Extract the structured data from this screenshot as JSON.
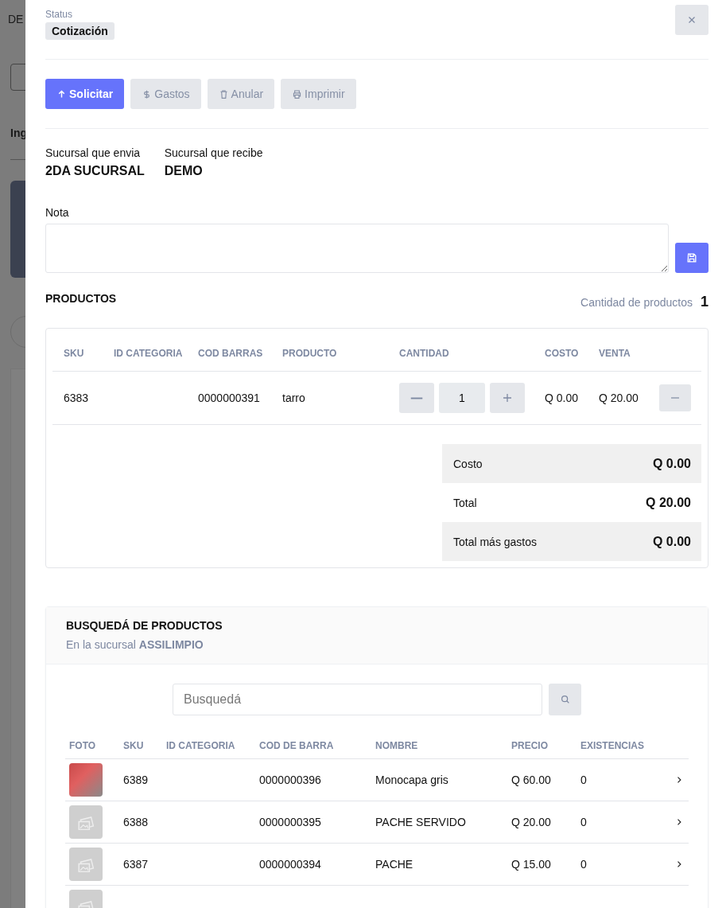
{
  "backdrop": {
    "texts": [
      "DE",
      "Ing"
    ]
  },
  "drawer": {
    "status": {
      "label": "Status",
      "value": "Cotización"
    },
    "actions": [
      {
        "label": "Solicitar",
        "kind": "request"
      },
      {
        "label": "Gastos",
        "kind": "expenses"
      },
      {
        "label": "Anular",
        "kind": "void"
      },
      {
        "label": "Imprimir",
        "kind": "print"
      }
    ],
    "branches": [
      {
        "label": "Sucursal que envia",
        "value": "2DA SUCURSAL"
      },
      {
        "label": "Sucursal que recibe",
        "value": "DEMO"
      }
    ],
    "note": {
      "label": "Nota"
    },
    "products": {
      "title": "PRODUCTOS",
      "count_label": "Cantidad de productos",
      "count": "1",
      "columns": [
        "SKU",
        "ID CATEGORIA",
        "COD BARRAS",
        "PRODUCTO",
        "CANTIDAD",
        "COSTO",
        "VENTA"
      ],
      "rows": [
        {
          "sku": "6383",
          "barcode": "0000000391",
          "product": "tarro",
          "quantity": "1",
          "cost": "Q 0.00",
          "sale": "Q 20.00"
        }
      ],
      "summary": [
        {
          "label": "Costo",
          "value": "Q 0.00",
          "shaded": true
        },
        {
          "label": "Total",
          "value": "Q 20.00",
          "shaded": false
        },
        {
          "label": "Total más gastos",
          "value": "Q 0.00",
          "shaded": true
        }
      ]
    },
    "search": {
      "title": "BUSQUEDÁ DE PRODUCTOS",
      "subtitle": "En la sucursal **ASSILIMPIO**",
      "placeholder": "Busquedá",
      "columns": [
        "FOTO",
        "SKU",
        "ID CATEGORIA",
        "COD DE BARRA",
        "NOMBRE",
        "PRECIO",
        "EXISTENCIAS"
      ],
      "rows": [
        {
          "has_photo": true,
          "sku": "6389",
          "barcode": "0000000396",
          "name": "Monocapa gris",
          "price": "Q 60.00",
          "stock": "0"
        },
        {
          "has_photo": false,
          "sku": "6388",
          "barcode": "0000000395",
          "name": "PACHE SERVIDO",
          "price": "Q 20.00",
          "stock": "0"
        },
        {
          "has_photo": false,
          "sku": "6387",
          "barcode": "0000000394",
          "name": "PACHE",
          "price": "Q 15.00",
          "stock": "0"
        },
        {
          "has_photo": false
        }
      ]
    }
  }
}
